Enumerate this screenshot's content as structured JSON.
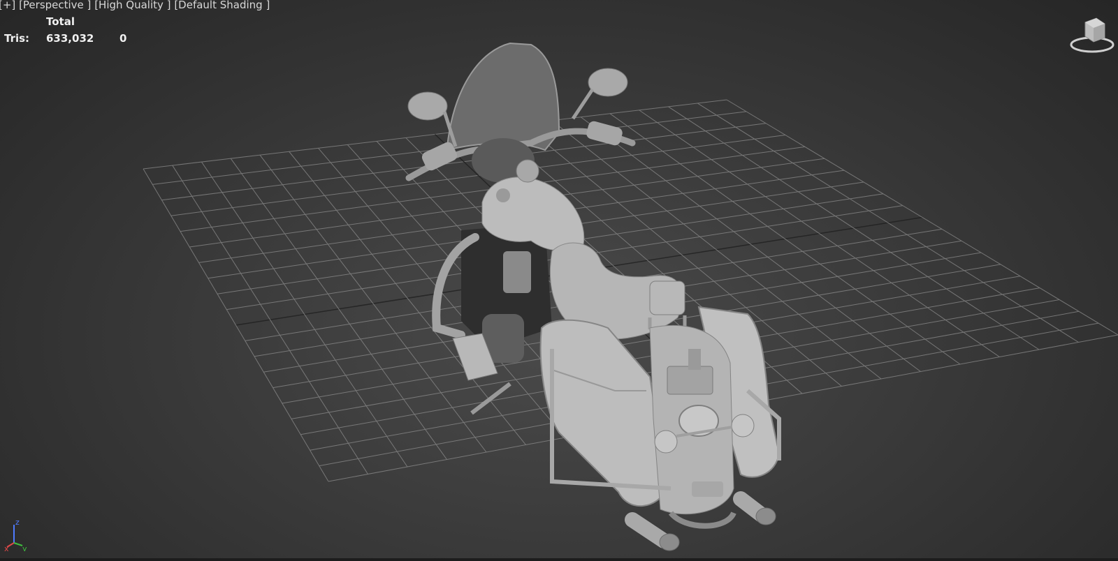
{
  "viewport": {
    "labels": [
      "[+]",
      "[Perspective ]",
      "[High Quality ]",
      "[Default Shading ]"
    ],
    "stats": {
      "header": "Total",
      "tris_label": "Tris:",
      "tris_total": "633,032",
      "tris_selected": "0"
    }
  },
  "viewcube": {
    "icon": "viewcube-icon"
  },
  "axis": {
    "icon": "axis-tripod-icon",
    "x_label": "x",
    "y_label": "y",
    "z_label": "z"
  },
  "colors": {
    "background": "#3a3a3a",
    "grid": "#8a8a8a",
    "model": "#b4b4b4",
    "label": "#d8d8d8"
  }
}
